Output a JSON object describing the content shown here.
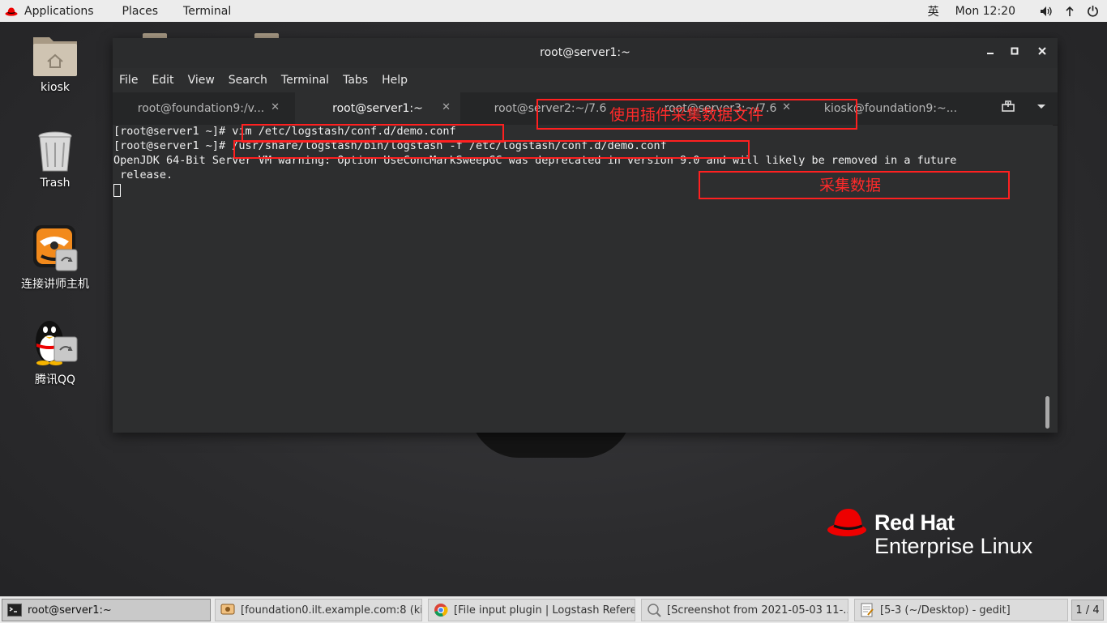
{
  "topbar": {
    "applications": "Applications",
    "places": "Places",
    "terminal": "Terminal",
    "input_method": "英",
    "clock": "Mon 12:20"
  },
  "desktop": {
    "icons": [
      {
        "label": "kiosk",
        "icon": "home-folder-icon"
      },
      {
        "label": "Trash",
        "icon": "trash-icon"
      },
      {
        "label": "连接讲师主机",
        "icon": "remote-desktop-icon"
      },
      {
        "label": "腾讯QQ",
        "icon": "qq-penguin-icon"
      }
    ]
  },
  "brand": {
    "line1": "Red Hat",
    "line2": "Enterprise Linux"
  },
  "window": {
    "title": "root@server1:~",
    "menu": [
      "File",
      "Edit",
      "View",
      "Search",
      "Terminal",
      "Tabs",
      "Help"
    ],
    "tabs": [
      {
        "label": "root@foundation9:/v..."
      },
      {
        "label": "root@server1:~",
        "active": true
      },
      {
        "label": "root@server2:~/7.6"
      },
      {
        "label": "root@server3:~/7.6"
      },
      {
        "label": "kiosk@foundation9:~..."
      }
    ],
    "terminal_lines": [
      "[root@server1 ~]# vim /etc/logstash/conf.d/demo.conf",
      "[root@server1 ~]# /usr/share/logstash/bin/logstash -f /etc/logstash/conf.d/demo.conf",
      "OpenJDK 64-Bit Server VM warning: Option UseConcMarkSweepGC was deprecated in version 9.0 and will likely be removed in a future",
      " release."
    ]
  },
  "annotations": {
    "note1": "使用插件采集数据文件",
    "note2": "采集数据"
  },
  "taskbar": {
    "items": [
      {
        "label": "root@server1:~",
        "active": true
      },
      {
        "label": "[foundation0.ilt.example.com:8 (kio..."
      },
      {
        "label": "[File input plugin | Logstash Refere..."
      },
      {
        "label": "[Screenshot from 2021-05-03 11-..."
      },
      {
        "label": "[5-3 (~/Desktop) - gedit]"
      }
    ],
    "pager": "1 / 4"
  },
  "colors": {
    "annotation_red": "#ff2020",
    "redhat_red": "#ee0000"
  }
}
